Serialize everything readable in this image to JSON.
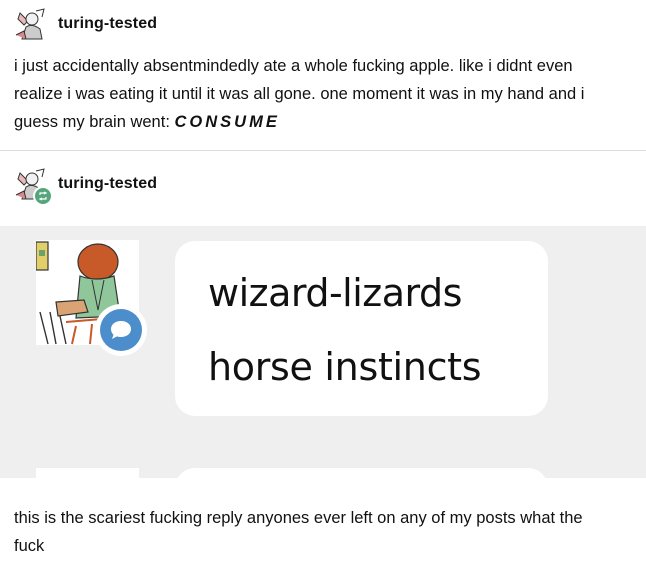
{
  "post1": {
    "username": "turing-tested",
    "text_line1": "i just accidentally absentmindedly ate a whole fucking apple. like i didnt even",
    "text_line2": "realize i was eating it until it was all gone. one moment it was in my hand and i",
    "text_line3_prefix": "guess my brain went: ",
    "text_emphasis": "CONSUME"
  },
  "post2": {
    "username": "turing-tested",
    "reblog_icon": "reblog-icon",
    "screenshot": {
      "reply_username": "wizard-lizards",
      "reply_text": "horse instincts",
      "reply_icon": "speech-bubble-icon",
      "accent_color": "#4c8ecb"
    },
    "text_line1": "this is the scariest fucking reply anyones ever left on any of my posts what the",
    "text_line2": "fuck"
  },
  "colors": {
    "reblog_green": "#55a67c",
    "screenshot_bg": "#efefef",
    "divider": "#dddddd"
  }
}
